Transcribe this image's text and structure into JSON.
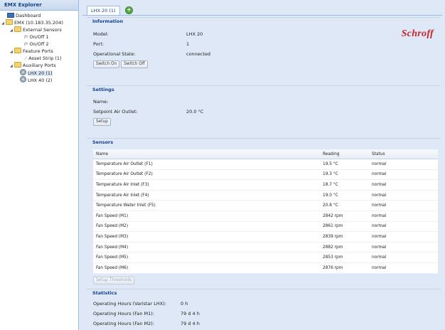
{
  "explorer": {
    "title": "EMX Explorer",
    "tree": [
      {
        "label": "Dashboard",
        "icon": "dashboard-icon",
        "level": 0
      },
      {
        "label": "EMX (10.183.35.204)",
        "icon": "folder-icon",
        "level": 0
      },
      {
        "label": "External Sensors",
        "icon": "folder-icon",
        "level": 1
      },
      {
        "label": "On/Off 1",
        "icon": "sensor-icon",
        "level": 2
      },
      {
        "label": "On/Off 2",
        "icon": "sensor-icon",
        "level": 2
      },
      {
        "label": "Feature Ports",
        "icon": "folder-icon",
        "level": 1
      },
      {
        "label": "Asset Strip (1)",
        "icon": "asset-strip-icon",
        "level": 2
      },
      {
        "label": "Auxiliary Ports",
        "icon": "folder-icon",
        "level": 1
      },
      {
        "label": "LHX 20 (1)",
        "icon": "fan-icon",
        "level": 2
      },
      {
        "label": "LHX 40 (2)",
        "icon": "fan-icon",
        "level": 2
      }
    ]
  },
  "tabs": {
    "active": "LHX 20 (1)"
  },
  "information": {
    "title": "Information",
    "model_label": "Model:",
    "model_value": "LHX 20",
    "port_label": "Port:",
    "port_value": "1",
    "state_label": "Operational State:",
    "state_value": "connected",
    "switch_on": "Switch On",
    "switch_off": "Switch Off",
    "brand": "Schroff"
  },
  "settings": {
    "title": "Settings",
    "name_label": "Name:",
    "name_value": "",
    "setpoint_label": "Setpoint Air Outlet:",
    "setpoint_value": "20.0 °C",
    "setup": "Setup"
  },
  "sensors": {
    "title": "Sensors",
    "columns": [
      "Name",
      "Reading",
      "Status"
    ],
    "rows": [
      [
        "Temperature Air Outlet (F1)",
        "19.5 °C",
        "normal"
      ],
      [
        "Temperature Air Outlet (F2)",
        "19.3 °C",
        "normal"
      ],
      [
        "Temperature Air Inlet (F3)",
        "18.7 °C",
        "normal"
      ],
      [
        "Temperature Air Inlet (F4)",
        "19.0 °C",
        "normal"
      ],
      [
        "Temperature Water Inlet (F5)",
        "20.8 °C",
        "normal"
      ],
      [
        "Fan Speed (M1)",
        "2842 rpm",
        "normal"
      ],
      [
        "Fan Speed (M2)",
        "2861 rpm",
        "normal"
      ],
      [
        "Fan Speed (M3)",
        "2839 rpm",
        "normal"
      ],
      [
        "Fan Speed (M4)",
        "2882 rpm",
        "normal"
      ],
      [
        "Fan Speed (M5)",
        "2853 rpm",
        "normal"
      ],
      [
        "Fan Speed (M6)",
        "2876 rpm",
        "normal"
      ]
    ],
    "setup_thresholds": "Setup Thresholds"
  },
  "statistics": {
    "title": "Statistics",
    "items": [
      {
        "label": "Operating Hours (Varistar LHX):",
        "value": "0 h"
      },
      {
        "label": "Operating Hours (Fan M1):",
        "value": "79 d 4 h"
      },
      {
        "label": "Operating Hours (Fan M2):",
        "value": "79 d 4 h"
      }
    ]
  },
  "colors": {
    "accent": "#15428b",
    "brand": "#c3262a",
    "panel_bg": "#dfe8f6"
  }
}
